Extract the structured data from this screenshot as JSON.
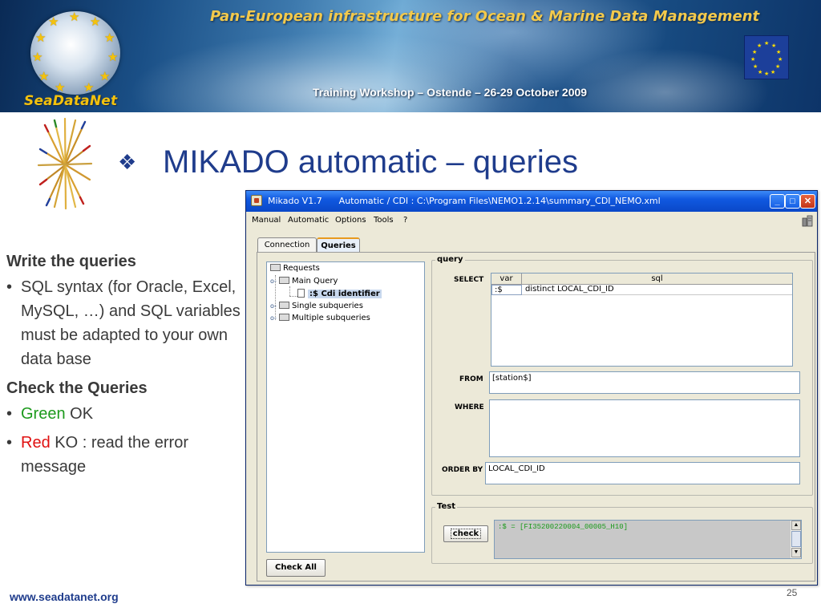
{
  "banner": {
    "title": "Pan-European infrastructure for Ocean & Marine Data Management",
    "subtitle": "Training Workshop – Ostende – 26-29 October 2009",
    "logo_text": "SeaDataNet",
    "logo_icon": "seadatanet-globe-logo",
    "flag_icon": "eu-flag-icon"
  },
  "slide": {
    "bullet_glyph": "❖",
    "title": "MIKADO automatic – queries",
    "decor_icon": "mikado-sticks-icon"
  },
  "left_text": {
    "heading1": "Write the queries",
    "item1": "SQL syntax (for Oracle, Excel, MySQL, …) and SQL variables must be adapted to your own data base",
    "heading2": "Check the Queries",
    "item2_colored": "Green",
    "item2_rest": " OK",
    "item3_colored": "Red",
    "item3_rest": " KO : read the error message",
    "bullet": "•",
    "colors": {
      "green": "#1c9a1c",
      "red": "#e01010",
      "text": "#3a3a3a"
    }
  },
  "footer": {
    "url": "www.seadatanet.org",
    "page_number": "25"
  },
  "app": {
    "window_title": "Mikado V1.7      Automatic / CDI : C:\\Program Files\\NEMO1.2.14\\summary_CDI_NEMO.xml",
    "window_buttons": {
      "minimize": "_",
      "maximize": "□",
      "close": "✕"
    },
    "menu": [
      "Manual",
      "Automatic",
      "Options",
      "Tools",
      "?"
    ],
    "tabs": [
      {
        "label": "Connection",
        "active": false
      },
      {
        "label": "Queries",
        "active": true
      }
    ],
    "tree": {
      "root": "Requests",
      "main_query": "Main Query",
      "selected_leaf": ":$ Cdi identifier",
      "single": "Single subqueries",
      "multiple": "Multiple subqueries"
    },
    "check_all_label": "Check All",
    "query_group_label": "query",
    "select_label": "SELECT",
    "select_table": {
      "columns": [
        "var",
        "sql"
      ],
      "rows": [
        {
          "var": ":$",
          "sql": "distinct LOCAL_CDI_ID"
        }
      ]
    },
    "from_label": "FROM",
    "from_value": "[station$]",
    "where_label": "WHERE",
    "where_value": "",
    "orderby_label": "ORDER BY",
    "orderby_value": "LOCAL_CDI_ID",
    "test_group_label": "Test",
    "check_label": "check",
    "test_output": ":$ = [FI35200220004_00005_H10]",
    "accent": "#0a48c8"
  }
}
